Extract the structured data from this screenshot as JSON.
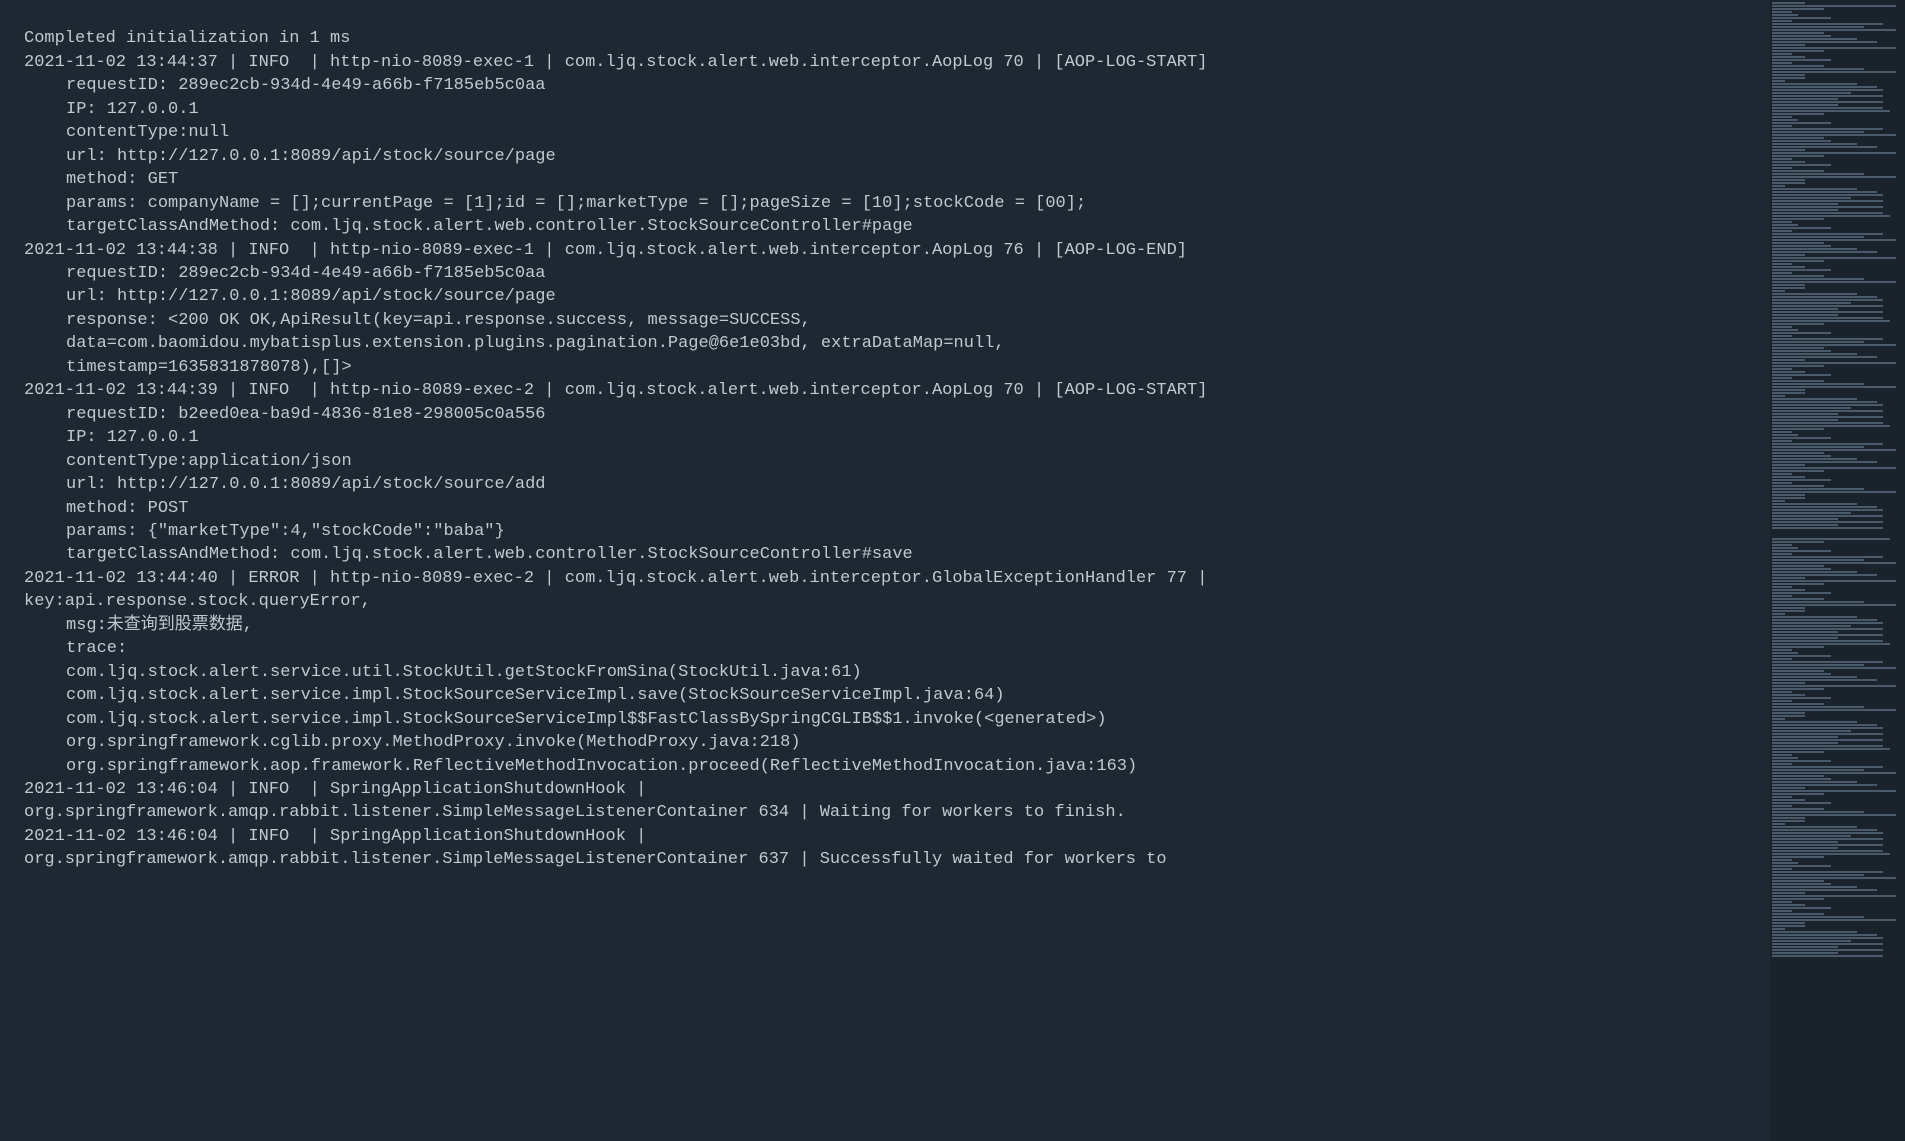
{
  "log_lines": [
    {
      "text": "Completed initialization in 1 ms",
      "indent": false
    },
    {
      "text": "2021-11-02 13:44:37 | INFO  | http-nio-8089-exec-1 | com.ljq.stock.alert.web.interceptor.AopLog 70 | [AOP-LOG-START]",
      "indent": false
    },
    {
      "text": "requestID: 289ec2cb-934d-4e49-a66b-f7185eb5c0aa",
      "indent": true
    },
    {
      "text": "IP: 127.0.0.1",
      "indent": true
    },
    {
      "text": "contentType:null",
      "indent": true
    },
    {
      "text": "url: http://127.0.0.1:8089/api/stock/source/page",
      "indent": true
    },
    {
      "text": "method: GET",
      "indent": true
    },
    {
      "text": "params: companyName = [];currentPage = [1];id = [];marketType = [];pageSize = [10];stockCode = [00];",
      "indent": true
    },
    {
      "text": "targetClassAndMethod: com.ljq.stock.alert.web.controller.StockSourceController#page",
      "indent": true
    },
    {
      "text": "2021-11-02 13:44:38 | INFO  | http-nio-8089-exec-1 | com.ljq.stock.alert.web.interceptor.AopLog 76 | [AOP-LOG-END]",
      "indent": false
    },
    {
      "text": "requestID: 289ec2cb-934d-4e49-a66b-f7185eb5c0aa",
      "indent": true
    },
    {
      "text": "url: http://127.0.0.1:8089/api/stock/source/page",
      "indent": true
    },
    {
      "text": "response: <200 OK OK,ApiResult(key=api.response.success, message=SUCCESS,",
      "indent": true
    },
    {
      "text": "data=com.baomidou.mybatisplus.extension.plugins.pagination.Page@6e1e03bd, extraDataMap=null,",
      "indent": true
    },
    {
      "text": "timestamp=1635831878078),[]>",
      "indent": true
    },
    {
      "text": "2021-11-02 13:44:39 | INFO  | http-nio-8089-exec-2 | com.ljq.stock.alert.web.interceptor.AopLog 70 | [AOP-LOG-START]",
      "indent": false
    },
    {
      "text": "requestID: b2eed0ea-ba9d-4836-81e8-298005c0a556",
      "indent": true
    },
    {
      "text": "IP: 127.0.0.1",
      "indent": true
    },
    {
      "text": "contentType:application/json",
      "indent": true
    },
    {
      "text": "url: http://127.0.0.1:8089/api/stock/source/add",
      "indent": true
    },
    {
      "text": "method: POST",
      "indent": true
    },
    {
      "text": "params: {\"marketType\":4,\"stockCode\":\"baba\"}",
      "indent": true
    },
    {
      "text": "targetClassAndMethod: com.ljq.stock.alert.web.controller.StockSourceController#save",
      "indent": true
    },
    {
      "text": "2021-11-02 13:44:40 | ERROR | http-nio-8089-exec-2 | com.ljq.stock.alert.web.interceptor.GlobalExceptionHandler 77 |",
      "indent": false
    },
    {
      "text": "key:api.response.stock.queryError,",
      "indent": false
    },
    {
      "text": "msg:未查询到股票数据,",
      "indent": true
    },
    {
      "text": "trace:",
      "indent": true
    },
    {
      "text": "com.ljq.stock.alert.service.util.StockUtil.getStockFromSina(StockUtil.java:61)",
      "indent": true
    },
    {
      "text": "com.ljq.stock.alert.service.impl.StockSourceServiceImpl.save(StockSourceServiceImpl.java:64)",
      "indent": true
    },
    {
      "text": "com.ljq.stock.alert.service.impl.StockSourceServiceImpl$$FastClassBySpringCGLIB$$1.invoke(<generated>)",
      "indent": true
    },
    {
      "text": "org.springframework.cglib.proxy.MethodProxy.invoke(MethodProxy.java:218)",
      "indent": true
    },
    {
      "text": "org.springframework.aop.framework.ReflectiveMethodInvocation.proceed(ReflectiveMethodInvocation.java:163)",
      "indent": true
    },
    {
      "text": "2021-11-02 13:46:04 | INFO  | SpringApplicationShutdownHook |",
      "indent": false
    },
    {
      "text": "org.springframework.amqp.rabbit.listener.SimpleMessageListenerContainer 634 | Waiting for workers to finish.",
      "indent": false
    },
    {
      "text": "2021-11-02 13:46:04 | INFO  | SpringApplicationShutdownHook |",
      "indent": false
    },
    {
      "text": "org.springframework.amqp.rabbit.listener.SimpleMessageListenerContainer 637 | Successfully waited for workers to",
      "indent": false
    }
  ],
  "minimap": {
    "line_widths": [
      "w25",
      "w95",
      "w40",
      "w15",
      "w20",
      "w45",
      "w15",
      "w85",
      "w70",
      "w95",
      "w40",
      "w45",
      "w65",
      "w80",
      "w25",
      "w95",
      "w40",
      "w15",
      "w25",
      "w45",
      "w15",
      "w40",
      "w70",
      "w95",
      "w25",
      "w25",
      "w10",
      "w65",
      "w80",
      "w85",
      "w60",
      "w85",
      "w50",
      "w85",
      "w50",
      "w85",
      "w90",
      "w40",
      "w15",
      "w20",
      "w45",
      "w15",
      "w85",
      "w70",
      "w95",
      "w40",
      "w45",
      "w65",
      "w80",
      "w25",
      "w95",
      "w40",
      "w15",
      "w25",
      "w45",
      "w15",
      "w40",
      "w70",
      "w95",
      "w25",
      "w25",
      "w10",
      "w65",
      "w80",
      "w85",
      "w60",
      "w85",
      "w50",
      "w85",
      "w50",
      "w85",
      "w90",
      "w40",
      "w15",
      "w20",
      "w45",
      "w15",
      "w85",
      "w70",
      "w95",
      "w40",
      "w45",
      "w65",
      "w80",
      "w25",
      "w95",
      "w40",
      "w15",
      "w25",
      "w45",
      "w15",
      "w40",
      "w70",
      "w95",
      "w25",
      "w25",
      "w10",
      "w65",
      "w80",
      "w85",
      "w60",
      "w85",
      "w50",
      "w85",
      "w50",
      "w85",
      "w90",
      "w40",
      "w15",
      "w20",
      "w45",
      "w15",
      "w85",
      "w70",
      "w95",
      "w40",
      "w45",
      "w65",
      "w80",
      "w25",
      "w95",
      "w40",
      "w15",
      "w25",
      "w45",
      "w15",
      "w40",
      "w70",
      "w95",
      "w25",
      "w25",
      "w10",
      "w65",
      "w80",
      "w85",
      "w60",
      "w85",
      "w50",
      "w85",
      "w50",
      "w85",
      "w90",
      "w40",
      "w15",
      "w20",
      "w45",
      "w15",
      "w85",
      "w70",
      "w95",
      "w40",
      "w45",
      "w65",
      "w80",
      "w25",
      "w95",
      "w40",
      "w15",
      "w25",
      "w45",
      "w15",
      "w40",
      "w70",
      "w95",
      "w25",
      "w25",
      "w10",
      "w65",
      "w80",
      "w85",
      "w60",
      "w85",
      "w50",
      "w85",
      "w50",
      "w85",
      "gap",
      "w90",
      "w40",
      "w15",
      "w20",
      "w45",
      "w15",
      "w85",
      "w70",
      "w95",
      "w40",
      "w45",
      "w65",
      "w80",
      "w25",
      "w95",
      "w40",
      "w15",
      "w25",
      "w45",
      "w15",
      "w40",
      "w70",
      "w95",
      "w25",
      "w25",
      "w10",
      "w65",
      "w80",
      "w85",
      "w60",
      "w85",
      "w50",
      "w85",
      "w50",
      "w85",
      "w90",
      "w40",
      "w15",
      "w20",
      "w45",
      "w15",
      "w85",
      "w70",
      "w95",
      "w40",
      "w45",
      "w65",
      "w80",
      "w25",
      "w95",
      "w40",
      "w15",
      "w25",
      "w45",
      "w15",
      "w40",
      "w70",
      "w95",
      "w25",
      "w25",
      "w10",
      "w65",
      "w80",
      "w85",
      "w60",
      "w85",
      "w50",
      "w85",
      "w50",
      "w85",
      "w90",
      "w40",
      "w15",
      "w20",
      "w45",
      "w15",
      "w85",
      "w70",
      "w95",
      "w40",
      "w45",
      "w65",
      "w80",
      "w25",
      "w95",
      "w40",
      "w15",
      "w25",
      "w45",
      "w15",
      "w40",
      "w70",
      "w95",
      "w25",
      "w25",
      "w10",
      "w65",
      "w80",
      "w85",
      "w60",
      "w85",
      "w50",
      "w85",
      "w50",
      "w85",
      "w90",
      "w40",
      "w15",
      "w20",
      "w45",
      "w15",
      "w85",
      "w70",
      "w95",
      "w40",
      "w45",
      "w65",
      "w80",
      "w25",
      "w95",
      "w40",
      "w15",
      "w25",
      "w45",
      "w15",
      "w40",
      "w70",
      "w95",
      "w25",
      "w25",
      "w10",
      "w65",
      "w80",
      "w85",
      "w60",
      "w85",
      "w50",
      "w85",
      "w50",
      "w85"
    ]
  }
}
